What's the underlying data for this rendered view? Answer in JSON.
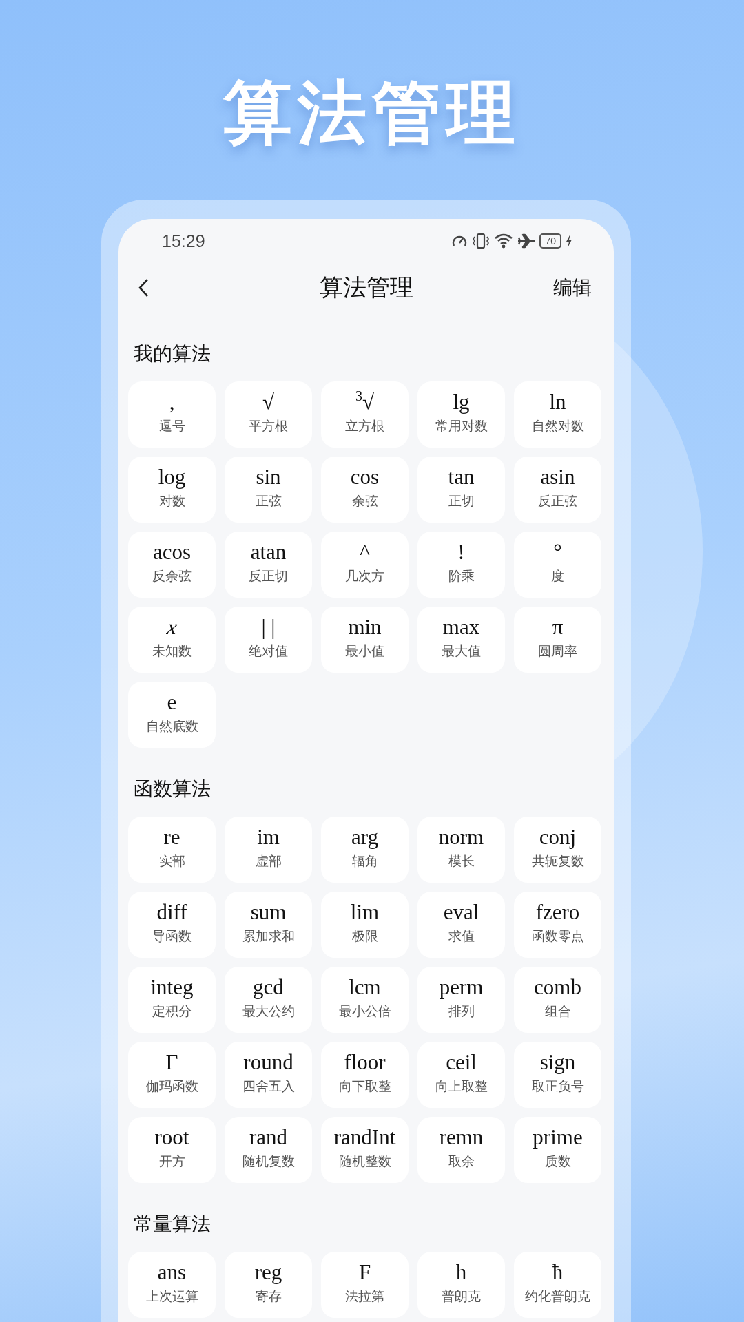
{
  "headline": "算法管理",
  "status_bar": {
    "time": "15:29",
    "battery": "70"
  },
  "nav": {
    "title": "算法管理",
    "action": "编辑"
  },
  "sections": [
    {
      "title": "我的算法",
      "items": [
        {
          "symbol": ",",
          "label": "逗号",
          "italic": false
        },
        {
          "symbol": "√",
          "label": "平方根",
          "italic": false
        },
        {
          "symbol": "$^{3}$√",
          "label": "立方根",
          "italic": false
        },
        {
          "symbol": "lg",
          "label": "常用对数",
          "italic": false
        },
        {
          "symbol": "ln",
          "label": "自然对数",
          "italic": false
        },
        {
          "symbol": "log",
          "label": "对数",
          "italic": false
        },
        {
          "symbol": "sin",
          "label": "正弦",
          "italic": false
        },
        {
          "symbol": "cos",
          "label": "余弦",
          "italic": false
        },
        {
          "symbol": "tan",
          "label": "正切",
          "italic": false
        },
        {
          "symbol": "asin",
          "label": "反正弦",
          "italic": false
        },
        {
          "symbol": "acos",
          "label": "反余弦",
          "italic": false
        },
        {
          "symbol": "atan",
          "label": "反正切",
          "italic": false
        },
        {
          "symbol": "^",
          "label": "几次方",
          "italic": false
        },
        {
          "symbol": "!",
          "label": "阶乘",
          "italic": false
        },
        {
          "symbol": "°",
          "label": "度",
          "italic": false
        },
        {
          "symbol": "x",
          "label": "未知数",
          "italic": true
        },
        {
          "symbol": "| |",
          "label": "绝对值",
          "italic": false
        },
        {
          "symbol": "min",
          "label": "最小值",
          "italic": false
        },
        {
          "symbol": "max",
          "label": "最大值",
          "italic": false
        },
        {
          "symbol": "π",
          "label": "圆周率",
          "italic": false
        },
        {
          "symbol": "e",
          "label": "自然底数",
          "italic": false
        }
      ]
    },
    {
      "title": "函数算法",
      "items": [
        {
          "symbol": "re",
          "label": "实部",
          "italic": false
        },
        {
          "symbol": "im",
          "label": "虚部",
          "italic": false
        },
        {
          "symbol": "arg",
          "label": "辐角",
          "italic": false
        },
        {
          "symbol": "norm",
          "label": "模长",
          "italic": false
        },
        {
          "symbol": "conj",
          "label": "共轭复数",
          "italic": false
        },
        {
          "symbol": "diff",
          "label": "导函数",
          "italic": false
        },
        {
          "symbol": "sum",
          "label": "累加求和",
          "italic": false
        },
        {
          "symbol": "lim",
          "label": "极限",
          "italic": false
        },
        {
          "symbol": "eval",
          "label": "求值",
          "italic": false
        },
        {
          "symbol": "fzero",
          "label": "函数零点",
          "italic": false
        },
        {
          "symbol": "integ",
          "label": "定积分",
          "italic": false
        },
        {
          "symbol": "gcd",
          "label": "最大公约",
          "italic": false
        },
        {
          "symbol": "lcm",
          "label": "最小公倍",
          "italic": false
        },
        {
          "symbol": "perm",
          "label": "排列",
          "italic": false
        },
        {
          "symbol": "comb",
          "label": "组合",
          "italic": false
        },
        {
          "symbol": "Γ",
          "label": "伽玛函数",
          "italic": false
        },
        {
          "symbol": "round",
          "label": "四舍五入",
          "italic": false
        },
        {
          "symbol": "floor",
          "label": "向下取整",
          "italic": false
        },
        {
          "symbol": "ceil",
          "label": "向上取整",
          "italic": false
        },
        {
          "symbol": "sign",
          "label": "取正负号",
          "italic": false
        },
        {
          "symbol": "root",
          "label": "开方",
          "italic": false
        },
        {
          "symbol": "rand",
          "label": "随机复数",
          "italic": false
        },
        {
          "symbol": "randInt",
          "label": "随机整数",
          "italic": false
        },
        {
          "symbol": "remn",
          "label": "取余",
          "italic": false
        },
        {
          "symbol": "prime",
          "label": "质数",
          "italic": false
        }
      ]
    },
    {
      "title": "常量算法",
      "items": [
        {
          "symbol": "ans",
          "label": "上次运算",
          "italic": false
        },
        {
          "symbol": "reg",
          "label": "寄存",
          "italic": false
        },
        {
          "symbol": "F",
          "label": "法拉第",
          "italic": false
        },
        {
          "symbol": "h",
          "label": "普朗克",
          "italic": false
        },
        {
          "symbol": "ħ",
          "label": "约化普朗克",
          "italic": false
        }
      ]
    }
  ]
}
